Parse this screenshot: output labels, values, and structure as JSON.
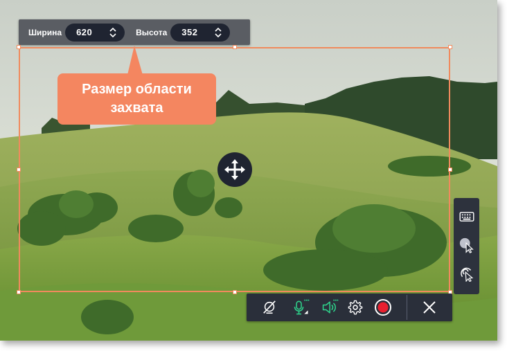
{
  "size_panel": {
    "width_label": "Ширина",
    "width_value": "620",
    "height_label": "Высота",
    "height_value": "352"
  },
  "callout": {
    "line1": "Размер области",
    "line2": "захвата"
  },
  "colors": {
    "accent": "#f48660",
    "region_border": "#f08a5d",
    "panel_dark": "#2a2f3a",
    "spinner_bg": "#1f2431",
    "mic_green": "#2ed18a",
    "record_red": "#e8202f"
  },
  "toolbar": {
    "icons": [
      "webcam-off-icon",
      "microphone-icon",
      "speaker-icon",
      "gear-icon",
      "record-button",
      "close-icon"
    ]
  },
  "side_panel": {
    "icons": [
      "keyboard-icon",
      "cursor-highlight-icon",
      "click-effect-icon"
    ]
  }
}
